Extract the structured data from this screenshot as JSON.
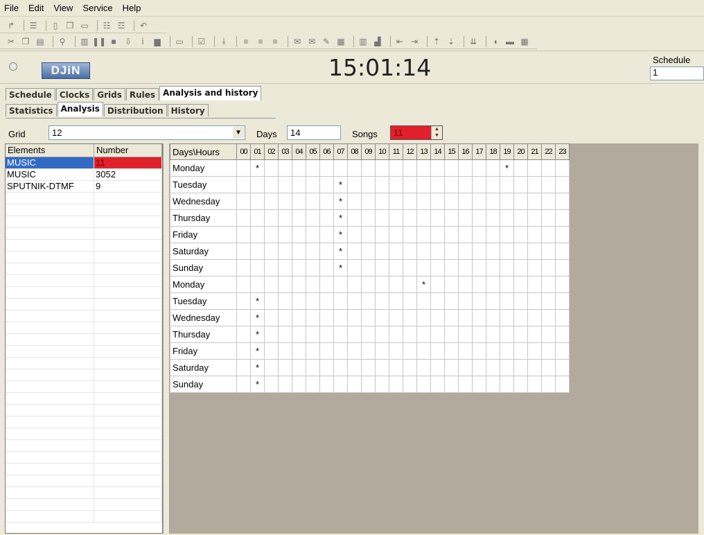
{
  "menu": [
    "File",
    "Edit",
    "View",
    "Service",
    "Help"
  ],
  "header": {
    "clock": "15:01:14",
    "logo_text": "DJiN",
    "schedule_label": "Schedule",
    "schedule_value": "1"
  },
  "tabs_main": [
    {
      "label": "Schedule",
      "active": false
    },
    {
      "label": "Clocks",
      "active": false
    },
    {
      "label": "Grids",
      "active": false
    },
    {
      "label": "Rules",
      "active": false
    },
    {
      "label": "Analysis and history",
      "active": true
    }
  ],
  "tabs_sub": [
    {
      "label": "Statistics",
      "active": false
    },
    {
      "label": "Analysis",
      "active": true
    },
    {
      "label": "Distribution",
      "active": false
    },
    {
      "label": "History",
      "active": false
    }
  ],
  "filter": {
    "grid_label": "Grid",
    "grid_value": "12",
    "days_label": "Days",
    "days_value": "14",
    "songs_label": "Songs",
    "songs_value": "11"
  },
  "colors": {
    "accent_red": "#e0202a",
    "selected_blue": "#316ac5"
  },
  "elements_table": {
    "headers": [
      "Elements",
      "Number"
    ],
    "rows": [
      {
        "name": "MUSIC",
        "number": "11",
        "selected": true
      },
      {
        "name": "MUSIC",
        "number": "3052",
        "selected": false
      },
      {
        "name": "SPUTNIK-DTMF",
        "number": "9",
        "selected": false
      }
    ]
  },
  "grid_table": {
    "corner": "Days\\Hours",
    "hours": [
      "00",
      "01",
      "02",
      "03",
      "04",
      "05",
      "06",
      "07",
      "08",
      "09",
      "10",
      "11",
      "12",
      "13",
      "14",
      "15",
      "16",
      "17",
      "18",
      "19",
      "20",
      "21",
      "22",
      "23"
    ],
    "mark": "*",
    "rows": [
      {
        "day": "Monday",
        "marks": [
          1,
          19
        ]
      },
      {
        "day": "Tuesday",
        "marks": [
          7
        ]
      },
      {
        "day": "Wednesday",
        "marks": [
          7
        ]
      },
      {
        "day": "Thursday",
        "marks": [
          7
        ]
      },
      {
        "day": "Friday",
        "marks": [
          7
        ]
      },
      {
        "day": "Saturday",
        "marks": [
          7
        ]
      },
      {
        "day": "Sunday",
        "marks": [
          7
        ]
      },
      {
        "day": "Monday",
        "marks": [
          13
        ]
      },
      {
        "day": "Tuesday",
        "marks": [
          1
        ]
      },
      {
        "day": "Wednesday",
        "marks": [
          1
        ]
      },
      {
        "day": "Thursday",
        "marks": [
          1
        ]
      },
      {
        "day": "Friday",
        "marks": [
          1
        ]
      },
      {
        "day": "Saturday",
        "marks": [
          1
        ]
      },
      {
        "day": "Sunday",
        "marks": [
          1
        ]
      }
    ]
  }
}
